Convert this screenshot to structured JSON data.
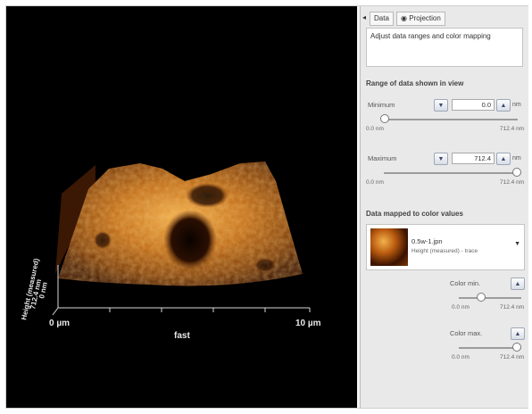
{
  "tabs": {
    "data": "Data",
    "projection": "Projection"
  },
  "description": "Adjust data ranges and color mapping",
  "range_section": {
    "title": "Range of data shown in view",
    "minimum": {
      "label": "Minimum",
      "value": "0.0",
      "unit": "nm",
      "low": "0.0 nm",
      "high": "712.4 nm",
      "level": 0.0
    },
    "maximum": {
      "label": "Maximum",
      "value": "712.4",
      "unit": "nm",
      "low": "0.0 nm",
      "high": "712.4 nm",
      "level": 1.0
    }
  },
  "color_section": {
    "title": "Data mapped to color values",
    "preview_title": "0.5w-1.jpn",
    "preview_sub": "Height (measured) - trace",
    "color_min": {
      "label": "Color min.",
      "low": "0.0 nm",
      "high": "712.4 nm",
      "level": 0.15
    },
    "color_max": {
      "label": "Color max.",
      "low": "0.0 nm",
      "high": "712.4 nm",
      "level": 1.0
    }
  },
  "viewport": {
    "x_start": "0 µm",
    "x_end": "10 µm",
    "x_label": "fast",
    "z_label": "Height (measured)",
    "z_value": "712.4 nm",
    "z_zero": "0 nm"
  },
  "icons": {
    "tab_icon": "eye-icon",
    "spin_up": "arrow-up-icon",
    "spin_down": "arrow-down-icon",
    "dropdown": "dropdown-arrow-icon"
  },
  "colors": {
    "surface_high": "#f0a23a",
    "surface_mid": "#b9620f",
    "surface_low": "#2a0e02",
    "background": "#000000"
  }
}
